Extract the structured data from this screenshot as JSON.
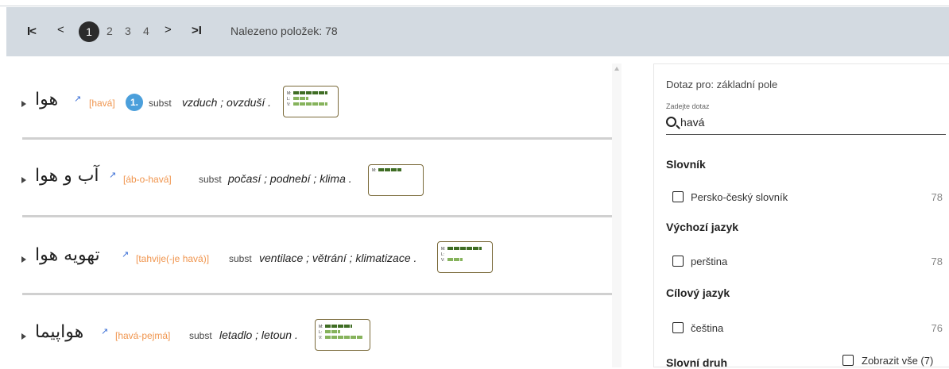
{
  "pager": {
    "first": "I<",
    "prev": "<",
    "current": "1",
    "pages": [
      "2",
      "3",
      "4"
    ],
    "next": ">",
    "last": ">I",
    "found": "Nalezeno položek: 78"
  },
  "results": [
    {
      "headword": "هوا",
      "link_icon": "↗",
      "translit": "[havá]",
      "sense_number": "1.",
      "pos": "subst",
      "meaning": "vzduch ; ovzduší .",
      "freq_labels": [
        "M:",
        "L:",
        "V:"
      ],
      "freq_levels": [
        0.9,
        0.4,
        0.9
      ]
    },
    {
      "headword": "آب و هوا",
      "link_icon": "↗",
      "translit": "[áb-o-havá]",
      "sense_number": "",
      "pos": "subst",
      "meaning": "počasí ; podnebí ; klima .",
      "freq_labels": [
        "M:"
      ],
      "freq_levels": [
        0.6
      ]
    },
    {
      "headword": "تهویه هوا",
      "link_icon": "↗",
      "translit": "[tahvije(-je havá)]",
      "sense_number": "",
      "pos": "subst",
      "meaning": "ventilace ; větrání ; klimatizace .",
      "freq_labels": [
        "M:",
        "L:",
        "V:"
      ],
      "freq_levels": [
        0.9,
        0.0,
        0.4
      ]
    },
    {
      "headword": "هواپیما",
      "link_icon": "↗",
      "translit": "[havá-pejmá]",
      "sense_number": "",
      "pos": "subst",
      "meaning": "letadlo ; letoun .",
      "freq_labels": [
        "M:",
        "L:",
        "V:"
      ],
      "freq_levels": [
        0.7,
        0.4,
        1.0
      ]
    }
  ],
  "colors": {
    "freq_dark": "#3f6d24",
    "freq_light": "#86b35c",
    "translit": "#f0954e",
    "sense_badge": "#4b9fdb"
  },
  "panel": {
    "query_title": "Dotaz pro: základní pole",
    "query_label": "Zadejte dotaz",
    "query_value": "havá",
    "sections": [
      {
        "title": "Slovník",
        "option": "Persko-český slovník",
        "count": "78"
      },
      {
        "title": "Výchozí jazyk",
        "option": "perština",
        "count": "78"
      },
      {
        "title": "Cílový jazyk",
        "option": "čeština",
        "count": "76"
      }
    ],
    "last_section": "Slovní druh",
    "show_all": "Zobrazit vše (7)"
  }
}
